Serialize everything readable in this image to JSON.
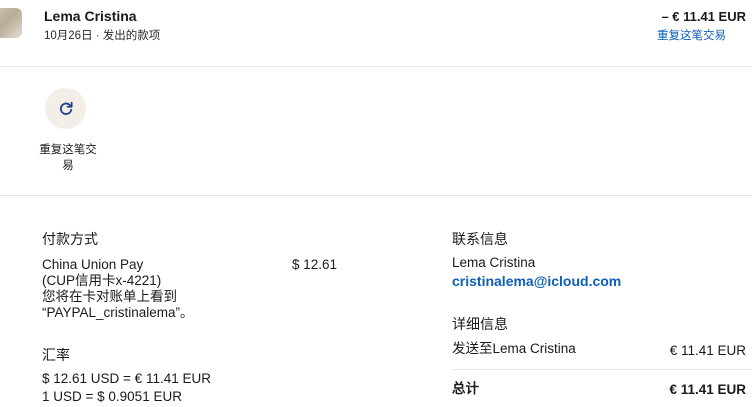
{
  "header": {
    "name": "Lema Cristina",
    "subtitle": "10月26日 · 发出的款项",
    "amount": "– € 11.41 EUR",
    "repeat_link": "重复这笔交易"
  },
  "actions": {
    "repeat": {
      "icon": "refresh-icon",
      "label": "重复这笔交易"
    }
  },
  "payment": {
    "title": "付款方式",
    "method_lines": [
      "China Union Pay",
      "(CUP信用卡x-4221)",
      "您将在卡对账单上看到",
      "“PAYPAL_cristinalema”。"
    ],
    "amount": "$ 12.61"
  },
  "exchange": {
    "title": "汇率",
    "lines": [
      "$ 12.61 USD = € 11.41 EUR",
      "1 USD = $ 0.9051 EUR"
    ]
  },
  "contact": {
    "title": "联系信息",
    "name": "Lema Cristina",
    "email": "cristinalema@icloud.com"
  },
  "details": {
    "title": "详细信息",
    "sent_to": "发送至Lema Cristina",
    "sent_amount": "€ 11.41 EUR",
    "total_label": "总计",
    "total_amount": "€ 11.41 EUR"
  },
  "colors": {
    "link": "#0d5fb8",
    "action_bg": "#f3efe8",
    "divider": "#e6e6e6"
  }
}
